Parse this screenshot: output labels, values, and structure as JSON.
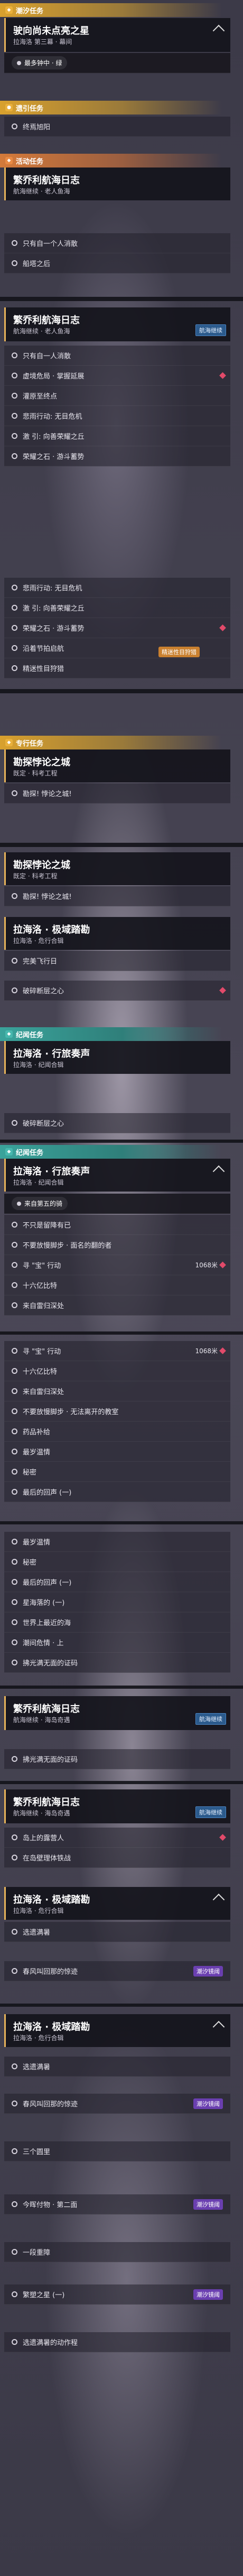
{
  "s1": {
    "title": "潮汐任务",
    "card_title": "驶向尚未点亮之星",
    "card_sub": "拉海洛 第三幕 · 幕间",
    "bubble": "最多钟中 · 绿"
  },
  "s2": {
    "title": "遗引任务",
    "item": "终焉旭阳"
  },
  "s3": {
    "title": "活动任务",
    "card_title": "繁乔利航海日志",
    "card_sub": "航海继续 · 老人鱼海",
    "items": [
      "只有我一人消散",
      "只有自一个人消散",
      "船塔之后"
    ]
  },
  "s4": {
    "card_title": "繁乔利航海日志",
    "card_sub": "航海继续 · 老人鱼海",
    "tag": "航海继续",
    "items": [
      "只有自一人消散",
      "虚境危局 · 掌握延展",
      "灌原至终点",
      "悲雨行动: 无目危机",
      "激 引: 向善荣耀之丘",
      "荣耀之石 · 游斗蓄势"
    ]
  },
  "s5": {
    "items": [
      "悲雨行动: 无目危机",
      "激 引: 向善荣耀之丘",
      "荣耀之石 · 游斗蓄势",
      "沿着节拍启航",
      "精迷性目狩猎"
    ],
    "badge": "精迷性目狩猎"
  },
  "s6": {
    "title": "专行任务",
    "card_title": "勘探悖论之城",
    "card_sub": "既定 · 科考工程",
    "item": "勘探! 悖论之城!"
  },
  "s7": {
    "card_title": "勘探悖论之城",
    "card_sub": "既定 · 科考工程",
    "item": "勘探! 悖论之城!",
    "card2_title": "拉海洛 · 极域踏勘",
    "card2_sub": "拉海洛 · 危行合辑",
    "items2": [
      "完美飞行日",
      "破碎断层之心"
    ]
  },
  "s8": {
    "title": "纪闻任务",
    "card_title": "拉海洛 · 行旅奏声",
    "card_sub": "拉海洛 · 纪闻合辑",
    "item": "破碎断层之心"
  },
  "s9": {
    "title": "纪闻任务",
    "card_title": "拉海洛 · 行旅奏声",
    "card_sub": "拉海洛 · 纪闻合辑",
    "bubble": "来自第五的骑",
    "items": [
      "不只是留降有已",
      "不要放慢脚步 · 面名的翻的者",
      "寻 \"宝\" 行动",
      "十六亿比特",
      "来自雷归深处"
    ],
    "dist": "1068米"
  },
  "s10": {
    "items": [
      "寻 \"宝\" 行动",
      "十六亿比特",
      "来自雷归深处",
      "不要放慢脚步 · 无法离开的教室",
      "药品补给",
      "最岁温情",
      "秘密",
      "最后的回声 (一)"
    ],
    "dist": "1068米"
  },
  "s11": {
    "items": [
      "最岁温情",
      "秘密",
      "最后的回声 (一)",
      "星海落的 (一)",
      "世界上最近的海",
      "潮间危情 · 上",
      "拂光满无面的证码"
    ]
  },
  "s12": {
    "card_title": "繁乔利航海日志",
    "card_sub": "航海继续 · 海岛奇遇",
    "tag": "航海继续",
    "item": "拂光满无面的证码"
  },
  "s13": {
    "card_title": "繁乔利航海日志",
    "card_sub": "航海继续 · 海岛奇遇",
    "tag": "航海继续",
    "items": [
      "岛上的露营人",
      "在岛壁理体铁战"
    ],
    "card2_title": "拉海洛 · 极域踏勘",
    "card2_sub": "拉海洛 · 危行合辑",
    "item2": "选遗满暑",
    "item3": "春风叫回那的惊迹",
    "badge": "潮汐镜阈"
  },
  "s14": {
    "card_title": "拉海洛 · 极域踏勘",
    "card_sub": "拉海洛 · 危行合辑",
    "items": [
      "选遗满暑",
      "春风叫回那的惊迹",
      "三个圆里",
      "今晖付物 · 第二面",
      "一段重障",
      "繁塑之星 (一)",
      "选遗满暑的动作程"
    ],
    "badge": "潮汐镜阈"
  }
}
